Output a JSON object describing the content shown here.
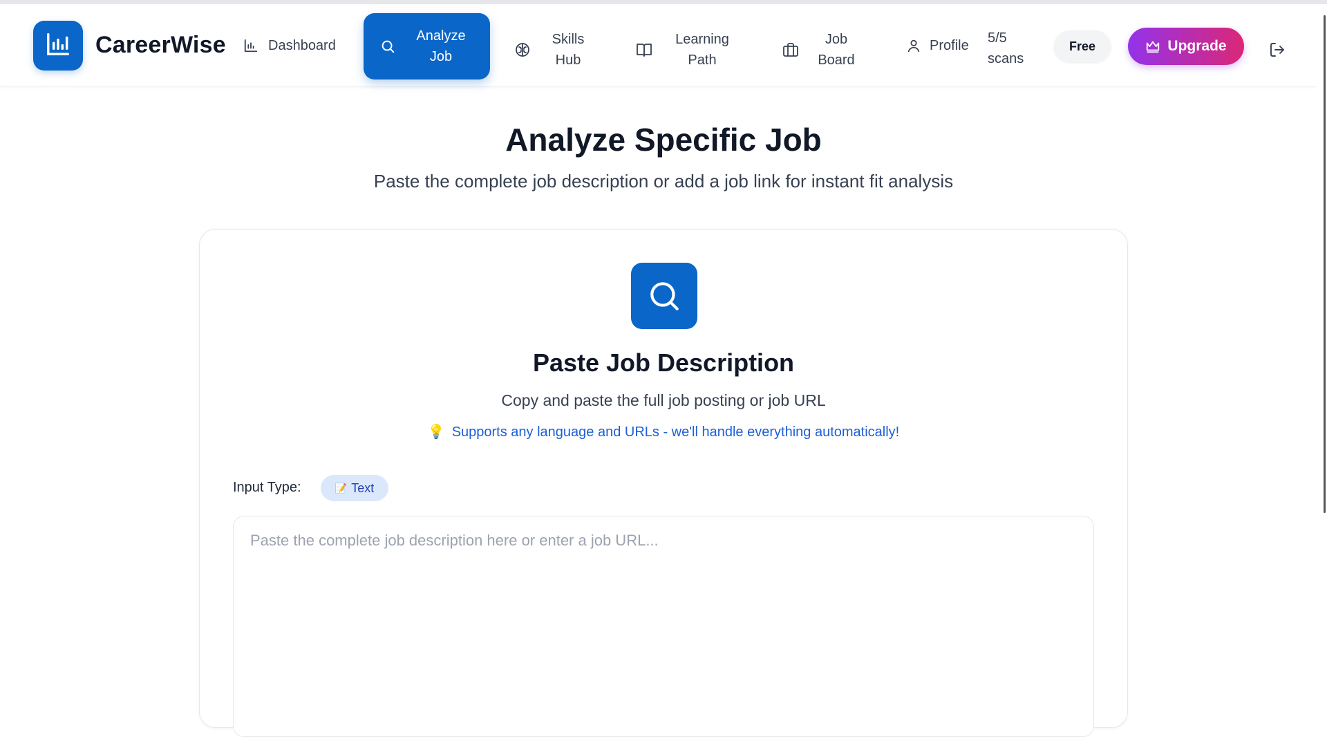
{
  "brand": {
    "name": "CareerWise",
    "logo_icon": "bar-chart-icon"
  },
  "nav": {
    "items": [
      {
        "label": "Dashboard",
        "icon": "bar-chart-icon"
      },
      {
        "label": "Analyze Job",
        "icon": "search-icon",
        "active": true
      },
      {
        "label": "Skills Hub",
        "icon": "brain-icon"
      },
      {
        "label": "Learning Path",
        "icon": "book-open-icon"
      },
      {
        "label": "Job Board",
        "icon": "briefcase-icon"
      },
      {
        "label": "Profile",
        "icon": "user-icon"
      }
    ],
    "scans": "5/5 scans",
    "plan_badge": "Free",
    "upgrade_label": "Upgrade",
    "upgrade_icon": "crown-icon",
    "logout_icon": "log-out-icon"
  },
  "page": {
    "title": "Analyze Specific Job",
    "subtitle": "Paste the complete job description or add a job link for instant fit analysis"
  },
  "card": {
    "icon": "search-icon",
    "title": "Paste Job Description",
    "subtitle": "Copy and paste the full job posting or job URL",
    "tip_emoji": "💡",
    "tip": "Supports any language and URLs - we'll handle everything automatically!",
    "input_type_label": "Input Type:",
    "input_type_value": "Text",
    "input_type_emoji": "📝",
    "textarea_placeholder": "Paste the complete job description here or enter a job URL...",
    "textarea_value": ""
  },
  "colors": {
    "primary": "#0a66c8",
    "upgrade_gradient_start": "#9333ea",
    "upgrade_gradient_end": "#db2777",
    "tip": "#1d5fd6"
  }
}
